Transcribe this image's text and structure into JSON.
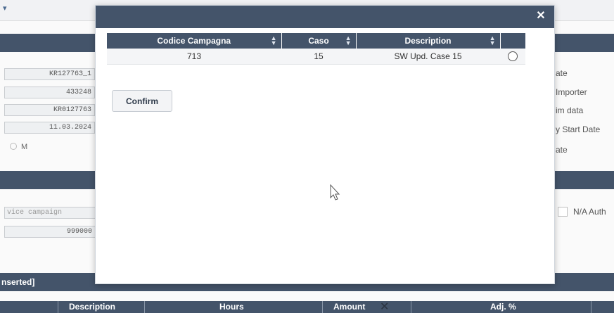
{
  "background": {
    "sections": {
      "inserted_label": "nserted]"
    },
    "left_fields": [
      "KR127763_1",
      "433248",
      "KR0127763",
      "11.03.2024"
    ],
    "radio_label": "M",
    "service_campaign_placeholder": "vice campaign",
    "service_campaign_value": "999000",
    "right_labels": [
      "ate",
      "Importer",
      "im data",
      "y Start Date",
      "ate"
    ],
    "na_label": "N/A Auth",
    "table_headers": [
      "Description",
      "Hours",
      "Amount",
      "Adj. %"
    ]
  },
  "modal": {
    "close_icon": "close-icon",
    "grid": {
      "columns": [
        "Codice Campagna",
        "Caso",
        "Description",
        ""
      ],
      "rows": [
        {
          "codice_campagna": "713",
          "caso": "15",
          "description": "SW Upd. Case 15",
          "selected": false
        }
      ]
    },
    "confirm_label": "Confirm"
  },
  "colors": {
    "header_bg": "#44546a",
    "header_text": "#ffffff",
    "row_bg": "#f4f5f7"
  }
}
